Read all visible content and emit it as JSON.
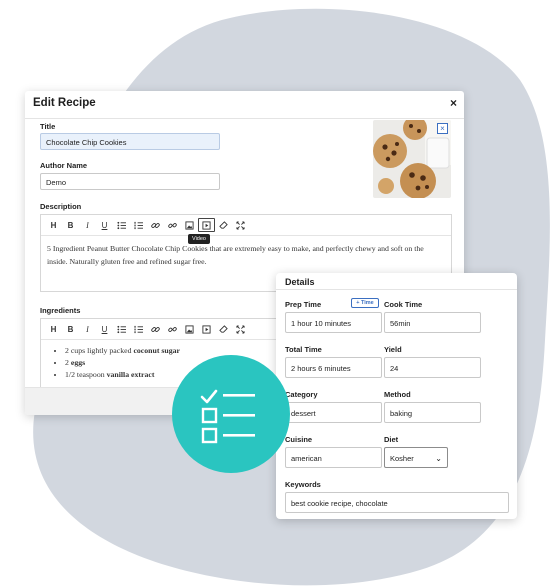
{
  "modal": {
    "title": "Edit Recipe",
    "close_glyph": "×",
    "title_label": "Title",
    "title_value": "Chocolate Chip Cookies",
    "author_label": "Author Name",
    "author_value": "Demo",
    "description_label": "Description",
    "description_text": "5 Ingredient Peanut Butter Chocolate Chip Cookies that are extremely easy to make, and perfectly chewy and soft on the inside. Naturally gluten free and refined sugar free.",
    "ingredients_label": "Ingredients",
    "video_tooltip": "Video",
    "toolbar": {
      "h": "H",
      "b": "B",
      "i": "I",
      "u": "U"
    },
    "image_remove_glyph": "×",
    "ingredients": [
      {
        "prefix": "2 cups lightly packed ",
        "bold": "coconut sugar"
      },
      {
        "prefix": "2 ",
        "bold": "eggs"
      },
      {
        "prefix": "1/2 teaspoon ",
        "bold": "vanilla extract"
      }
    ]
  },
  "details": {
    "title": "Details",
    "prep_label": "Prep Time",
    "add_time_label": "+ Time",
    "prep_value": "1 hour 10 minutes",
    "cook_label": "Cook Time",
    "cook_value": "56min",
    "total_label": "Total Time",
    "total_value": "2 hours 6 minutes",
    "yield_label": "Yield",
    "yield_value": "24",
    "category_label": "Category",
    "category_value": "dessert",
    "method_label": "Method",
    "method_value": "baking",
    "cuisine_label": "Cuisine",
    "cuisine_value": "american",
    "diet_label": "Diet",
    "diet_value": "Kosher",
    "keywords_label": "Keywords",
    "keywords_value": "best cookie recipe, chocolate"
  },
  "colors": {
    "accent": "#2ac5c0",
    "link": "#3b6fc1",
    "blob": "#d2d7df"
  }
}
